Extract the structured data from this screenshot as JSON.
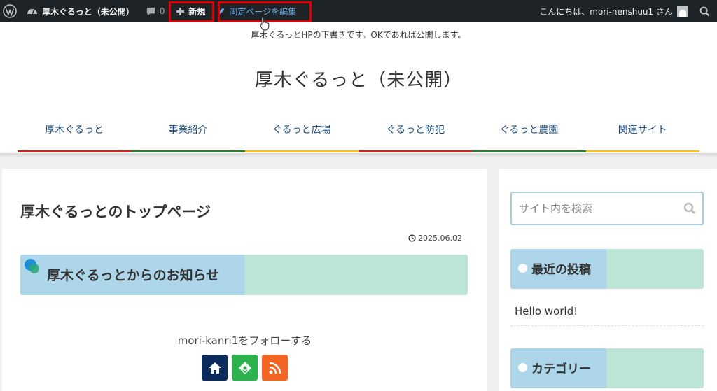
{
  "admin_bar": {
    "site_name": "厚木ぐるっと（未公開）",
    "comments_count": "0",
    "new_label": "新規",
    "edit_label": "固定ページを編集",
    "howdy": "こんにちは、mori-henshuu1 さん"
  },
  "header": {
    "tagline": "厚木ぐるっとHPの下書きです。OKであれば公開します。",
    "site_title": "厚木ぐるっと（未公開）",
    "nav": [
      {
        "label": "厚木ぐるっと",
        "color": "#c62828"
      },
      {
        "label": "事業紹介",
        "color": "#2e7d32"
      },
      {
        "label": "ぐるっと広場",
        "color": "#fbc02d"
      },
      {
        "label": "ぐるっと防犯",
        "color": "#c62828"
      },
      {
        "label": "ぐるっと農園",
        "color": "#2e7d32"
      },
      {
        "label": "関連サイト",
        "color": "#fbc02d"
      }
    ]
  },
  "main": {
    "page_title": "厚木ぐるっとのトップページ",
    "date": "2025.06.02",
    "notice_title": "厚木ぐるっとからのお知らせ",
    "follow_text": "mori-kanri1をフォローする",
    "follow_buttons": [
      {
        "icon": "home-icon",
        "color": "#0a2b5c"
      },
      {
        "icon": "feedly-icon",
        "color": "#2bb24c"
      },
      {
        "icon": "rss-icon",
        "color": "#f26522"
      }
    ]
  },
  "sidebar": {
    "search_placeholder": "サイト内を検索",
    "recent_posts_title": "最近の投稿",
    "recent_post": "Hello world!",
    "categories_title": "カテゴリー"
  },
  "colors": {
    "admin_bar_bg": "#1d2327",
    "heading_blue": "#aed6ea",
    "heading_green": "#bce5d5",
    "highlight": "#e00000"
  }
}
